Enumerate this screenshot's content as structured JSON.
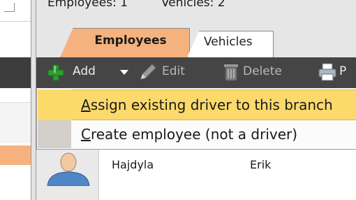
{
  "header": {
    "employees_count": "Employees:  1",
    "vehicles_count": "Vehicles:  2"
  },
  "tabs": [
    {
      "label": "Employees",
      "active": true
    },
    {
      "label": "Vehicles",
      "active": false
    }
  ],
  "toolbar": {
    "add_label": "Add",
    "edit_label": "Edit",
    "delete_label": "Delete",
    "print_label": "P"
  },
  "menu": {
    "items": [
      {
        "accel": "A",
        "rest": "ssign existing driver to this branch",
        "highlighted": true
      },
      {
        "accel": "C",
        "rest": "reate employee (not a driver)",
        "highlighted": false
      }
    ]
  },
  "grid": {
    "rows": [
      {
        "last_name": "Hajdyla",
        "first_name": "Erik",
        "icon": "user-avatar-icon"
      }
    ]
  },
  "colors": {
    "active_tab": "#f6b27e",
    "toolbar_bg": "#454545",
    "menu_highlight": "#fbd96b",
    "add_icon": "#2f9e2f"
  }
}
